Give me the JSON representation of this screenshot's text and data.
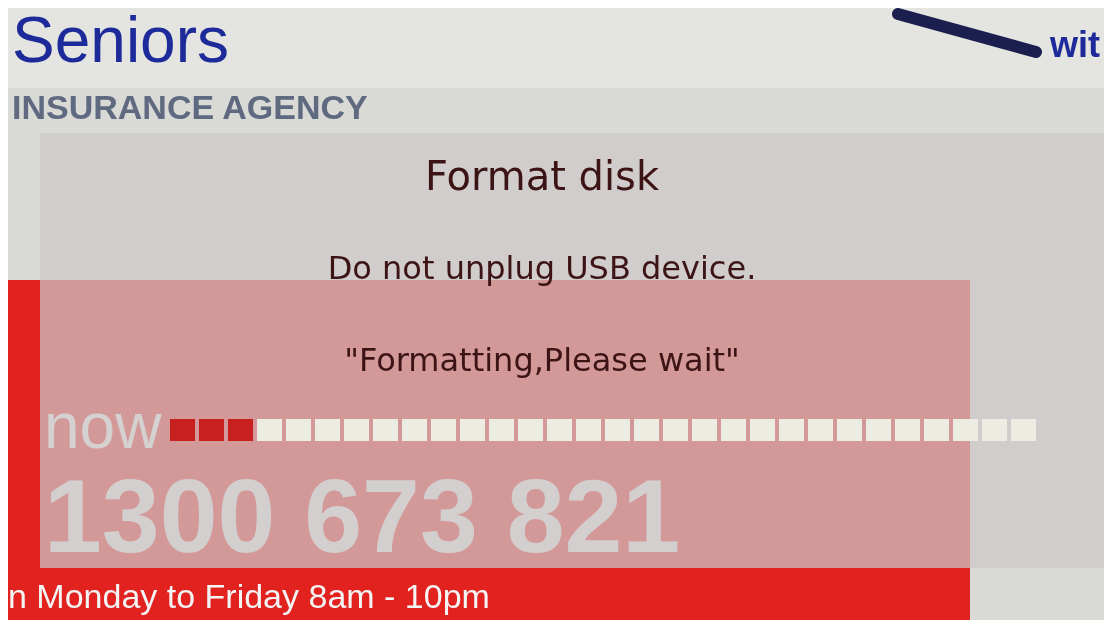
{
  "advert": {
    "brand": "Seniors",
    "tagline": "INSURANCE AGENCY",
    "corner_text": "wit",
    "call_word": "now",
    "phone": "1300 673 821",
    "hours": "n Monday to Friday 8am - 10pm"
  },
  "dialog": {
    "title": "Format disk",
    "warning": "Do not unplug USB device.",
    "status": "\"Formatting,Please wait\"",
    "progress": {
      "level": 0.1
    }
  }
}
